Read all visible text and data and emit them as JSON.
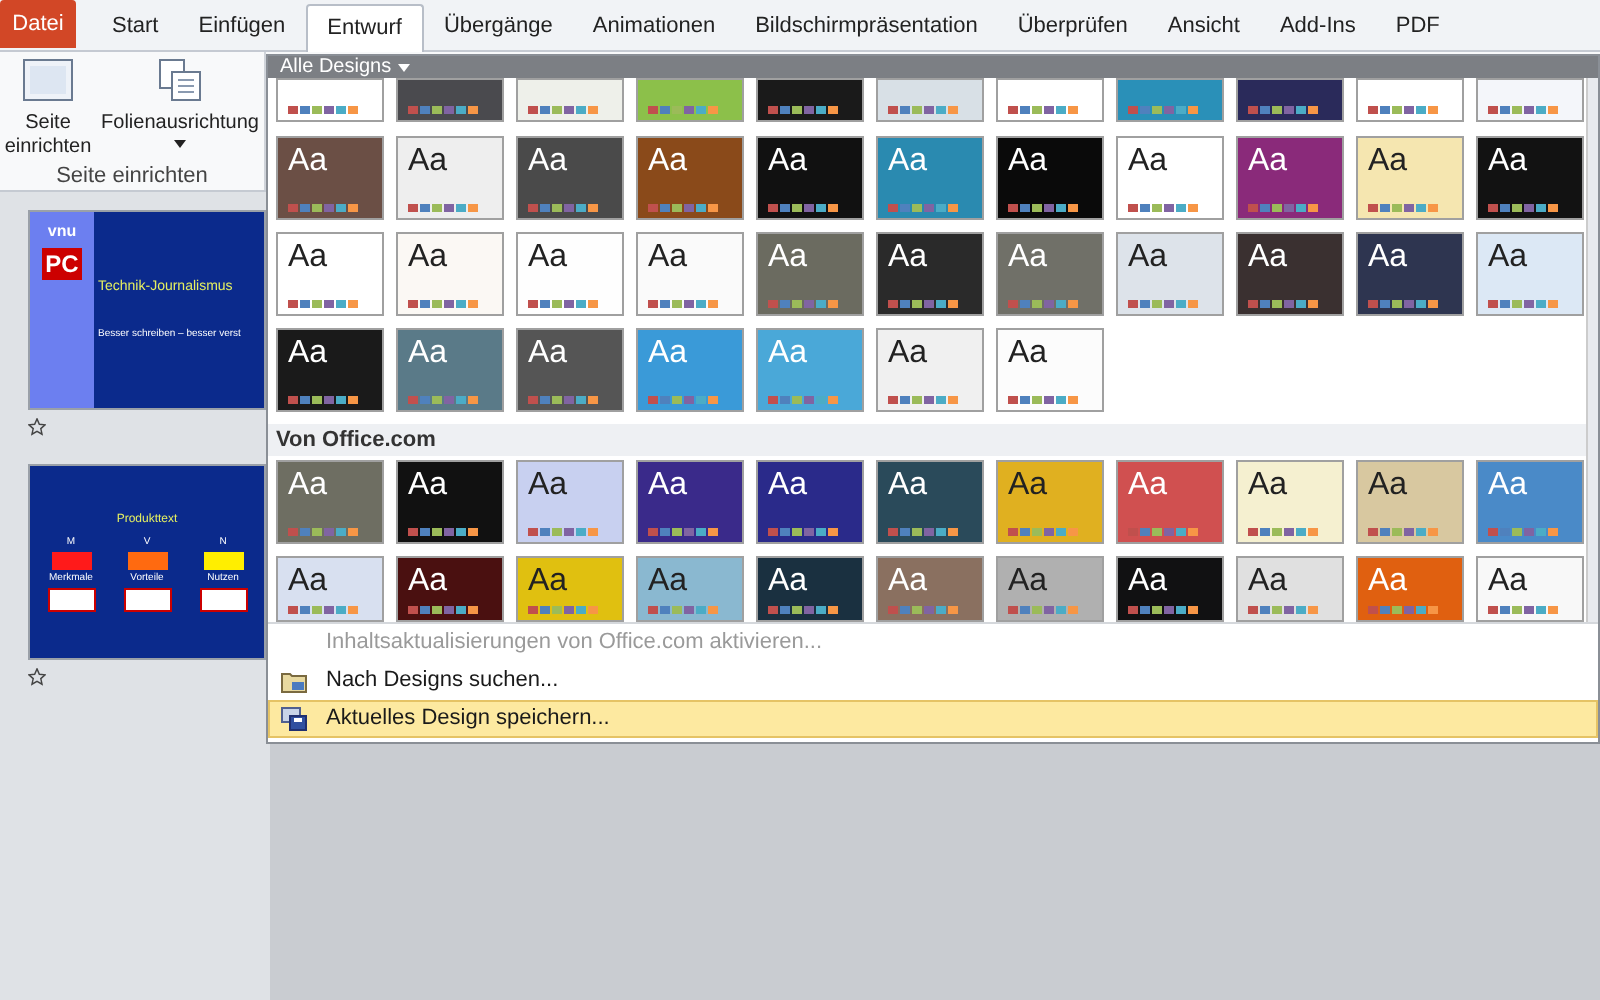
{
  "file_tab": {
    "label": "Datei"
  },
  "tabs": [
    {
      "label": "Start",
      "selected": false
    },
    {
      "label": "Einfügen",
      "selected": false
    },
    {
      "label": "Entwurf",
      "selected": true
    },
    {
      "label": "Übergänge",
      "selected": false
    },
    {
      "label": "Animationen",
      "selected": false
    },
    {
      "label": "Bildschirmpräsentation",
      "selected": false
    },
    {
      "label": "Überprüfen",
      "selected": false
    },
    {
      "label": "Ansicht",
      "selected": false
    },
    {
      "label": "Add-Ins",
      "selected": false
    },
    {
      "label": "PDF",
      "selected": false
    }
  ],
  "ribbon": {
    "buttons": [
      {
        "kind": "page",
        "label": "Seite einrichten"
      },
      {
        "kind": "orientation",
        "label": "Folienausrichtung"
      }
    ],
    "group_label": "Seite einrichten"
  },
  "slides": [
    {
      "kind": "title",
      "logo": "vnu",
      "badge": "PC",
      "title": "Technik-Journalismus",
      "subtitle": "Besser schreiben – besser verst"
    },
    {
      "kind": "diagram",
      "title": "Produkttext",
      "columns": [
        {
          "letter": "M",
          "label": "Merkmale",
          "color": "#ff1a1a"
        },
        {
          "letter": "V",
          "label": "Vorteile",
          "color": "#ff6a10"
        },
        {
          "letter": "N",
          "label": "Nutzen",
          "color": "#ffee00"
        }
      ]
    }
  ],
  "gallery": {
    "header": "Alle Designs",
    "sections": [
      {
        "rows": [
          {
            "kind": "top",
            "tiles": [
              {
                "color": "#ffffff"
              },
              {
                "color": "#4a4a4e"
              },
              {
                "color": "#eef0ea"
              },
              {
                "color": "#8cc04a"
              },
              {
                "color": "#1a1a1a"
              },
              {
                "color": "#d8e0e6"
              },
              {
                "color": "#ffffff"
              },
              {
                "color": "#2a90b8"
              },
              {
                "color": "#2a2a5a"
              },
              {
                "color": "#ffffff"
              },
              {
                "color": "#f4f6fa"
              }
            ]
          },
          {
            "kind": "full",
            "tiles": [
              {
                "label": "Aa",
                "color": "#6b4f45"
              },
              {
                "label": "Aa",
                "color": "#eeeeee"
              },
              {
                "label": "Aa",
                "color": "#4a4a4a"
              },
              {
                "label": "Aa",
                "color": "#8a4a1a"
              },
              {
                "label": "Aa",
                "color": "#111111"
              },
              {
                "label": "Aa",
                "color": "#2a8ab0"
              },
              {
                "label": "Aa",
                "color": "#0a0a0a"
              },
              {
                "label": "Aa",
                "color": "#ffffff"
              },
              {
                "label": "Aa",
                "color": "#8a2a7a"
              },
              {
                "label": "Aa",
                "color": "#f5e6b0"
              },
              {
                "label": "Aa",
                "color": "#121212"
              }
            ]
          },
          {
            "kind": "full",
            "tiles": [
              {
                "label": "Aa",
                "color": "#ffffff"
              },
              {
                "label": "Aa",
                "color": "#fbf8f4"
              },
              {
                "label": "Aa",
                "color": "#fefefe"
              },
              {
                "label": "Aa",
                "color": "#fafafa"
              },
              {
                "label": "Aa",
                "color": "#6b6b60"
              },
              {
                "label": "Aa",
                "color": "#2a2a2a"
              },
              {
                "label": "Aa",
                "color": "#707068"
              },
              {
                "label": "Aa",
                "color": "#dde3ea"
              },
              {
                "label": "Aa",
                "color": "#3a3030"
              },
              {
                "label": "Aa",
                "color": "#2e3550"
              },
              {
                "label": "Aa",
                "color": "#dce8f5"
              }
            ]
          },
          {
            "kind": "full",
            "tiles": [
              {
                "label": "Aa",
                "color": "#1a1a1a"
              },
              {
                "label": "Aa",
                "color": "#5a7a88"
              },
              {
                "label": "Aa",
                "color": "#555555"
              },
              {
                "label": "Aa",
                "color": "#3a9ad8"
              },
              {
                "label": "Aa",
                "color": "#4aa8d8"
              },
              {
                "label": "Aa",
                "color": "#f0f0f0"
              },
              {
                "label": "Aa",
                "color": "#fcfcfc"
              }
            ]
          }
        ]
      },
      {
        "title": "Von Office.com",
        "rows": [
          {
            "kind": "full",
            "tiles": [
              {
                "label": "Aa",
                "color": "#6e6e62"
              },
              {
                "label": "Aa",
                "color": "#111111"
              },
              {
                "label": "Aa",
                "color": "#c8d0f0"
              },
              {
                "label": "Aa",
                "color": "#3a2a8a"
              },
              {
                "label": "Aa",
                "color": "#2a2a8a"
              },
              {
                "label": "Aa",
                "color": "#2a4a5a"
              },
              {
                "label": "Aa",
                "color": "#e0b020"
              },
              {
                "label": "Aa",
                "color": "#d05050"
              },
              {
                "label": "Aa",
                "color": "#f5f0d0"
              },
              {
                "label": "Aa",
                "color": "#d8c8a0"
              },
              {
                "label": "Aa",
                "color": "#4a8ac8"
              }
            ]
          },
          {
            "kind": "bottom",
            "tiles": [
              {
                "label": "Aa",
                "color": "#d8e0f0"
              },
              {
                "label": "Aa",
                "color": "#4a1010"
              },
              {
                "label": "Aa",
                "color": "#e0c010"
              },
              {
                "label": "Aa",
                "color": "#8ab8d0"
              },
              {
                "label": "Aa",
                "color": "#1a3040"
              },
              {
                "label": "Aa",
                "color": "#8a7060"
              },
              {
                "label": "Aa",
                "color": "#b0b0b0"
              },
              {
                "label": "Aa",
                "color": "#111112"
              },
              {
                "label": "Aa",
                "color": "#e0e0e0"
              },
              {
                "label": "Aa",
                "color": "#e06010"
              },
              {
                "label": "Aa",
                "color": "#f8f8f8"
              }
            ]
          }
        ]
      }
    ]
  },
  "menu": [
    {
      "kind": "plain",
      "label": "Inhaltsaktualisierungen von Office.com aktivieren...",
      "disabled": true,
      "selected": false
    },
    {
      "kind": "browse",
      "label": "Nach Designs suchen...",
      "disabled": false,
      "selected": false
    },
    {
      "kind": "save",
      "label": "Aktuelles Design speichern...",
      "disabled": false,
      "selected": true
    }
  ]
}
